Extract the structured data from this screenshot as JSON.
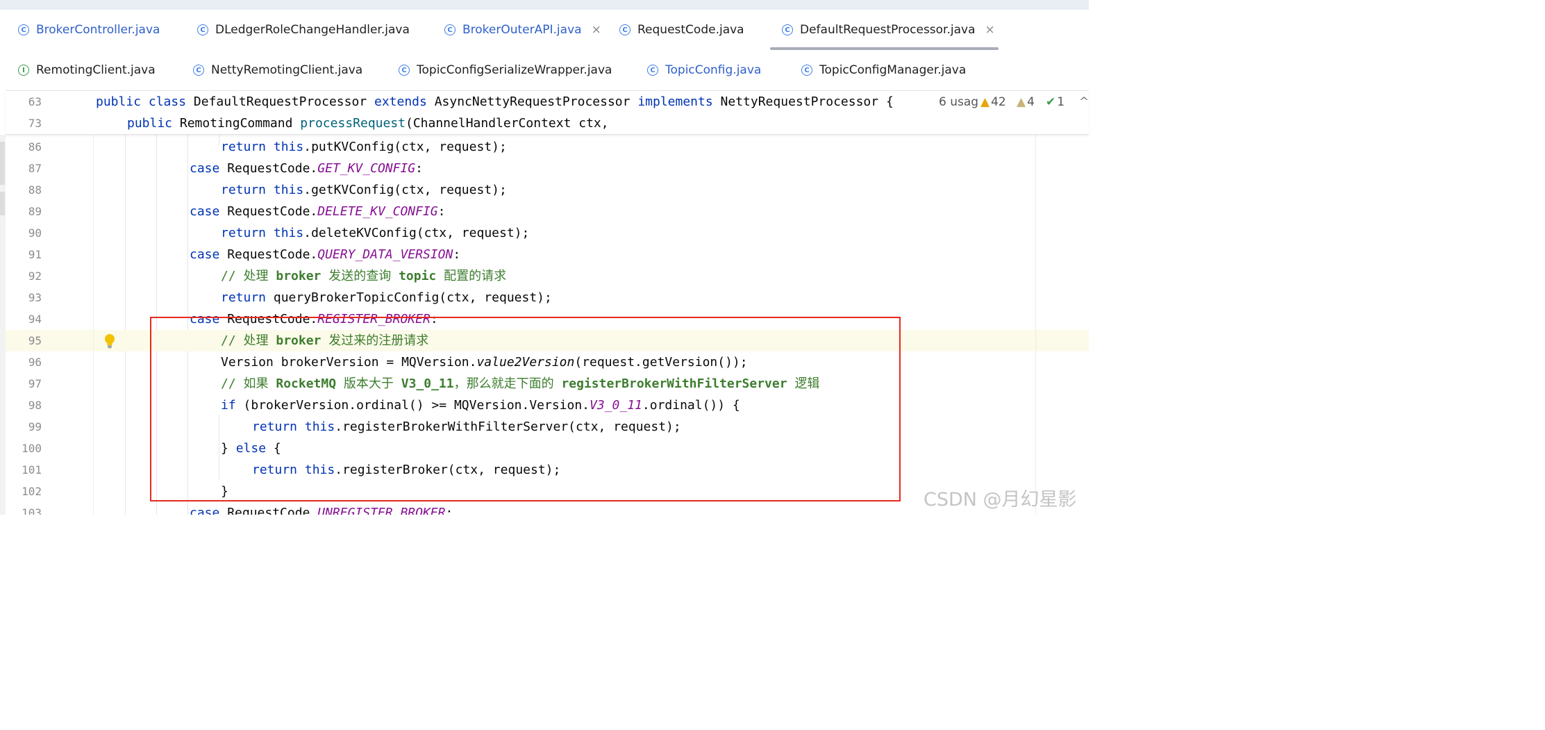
{
  "tabs_row1": [
    {
      "label": "BrokerController.java",
      "icon": "class-icon",
      "style": "blue",
      "close": false
    },
    {
      "label": "DLedgerRoleChangeHandler.java",
      "icon": "class-icon",
      "style": "normal",
      "close": false
    },
    {
      "label": "BrokerOuterAPI.java",
      "icon": "class-icon",
      "style": "blue",
      "close": true
    },
    {
      "label": "RequestCode.java",
      "icon": "class-icon",
      "style": "normal",
      "close": false
    },
    {
      "label": "DefaultRequestProcessor.java",
      "icon": "class-icon",
      "style": "active",
      "close": true
    }
  ],
  "tabs_row2": [
    {
      "label": "RemotingClient.java",
      "icon": "interface-icon",
      "style": "normal"
    },
    {
      "label": "NettyRemotingClient.java",
      "icon": "class-icon",
      "style": "normal"
    },
    {
      "label": "TopicConfigSerializeWrapper.java",
      "icon": "class-icon",
      "style": "normal"
    },
    {
      "label": "TopicConfig.java",
      "icon": "class-icon",
      "style": "blue"
    },
    {
      "label": "TopicConfigManager.java",
      "icon": "class-icon",
      "style": "normal"
    }
  ],
  "icon_glyphs": {
    "class": "C",
    "interface": "I",
    "close": "×"
  },
  "sticky": {
    "line63": "63",
    "line73": "73",
    "usages": "6 usag",
    "warnings": "42",
    "weak_warnings": "4",
    "typos": "1"
  },
  "line_numbers": [
    "86",
    "87",
    "88",
    "89",
    "90",
    "91",
    "92",
    "93",
    "94",
    "95",
    "96",
    "97",
    "98",
    "99",
    "100",
    "101",
    "102",
    "103"
  ],
  "code": {
    "kw_public": "public",
    "kw_class": "class",
    "class_name": "DefaultRequestProcessor",
    "kw_extends": "extends",
    "super_name": "AsyncNettyRequestProcessor",
    "kw_implements": "implements",
    "iface_name": "NettyRequestProcessor",
    "brace": "{",
    "ret_type": "RemotingCommand",
    "method_name": "processRequest",
    "method_args": "(ChannelHandlerContext ctx,",
    "kw_return": "return",
    "kw_this": "this",
    "kw_case": "case",
    "kw_if": "if",
    "kw_else": "else",
    "put_call": ".putKVConfig(ctx, request);",
    "get_call": ".getKVConfig(ctx, request);",
    "delete_call": ".deleteKVConfig(ctx, request);",
    "request_code": "RequestCode.",
    "const_get": "GET_KV_CONFIG",
    "const_delete": "DELETE_KV_CONFIG",
    "const_query": "QUERY_DATA_VERSION",
    "const_register": "REGISTER_BROKER",
    "const_unregister": "UNREGISTER_BROKER",
    "colon": ":",
    "comment92_a": "// 处理 ",
    "comment92_b": "broker",
    "comment92_c": " 发送的查询 ",
    "comment92_d": "topic",
    "comment92_e": " 配置的请求",
    "query_call": " queryBrokerTopicConfig(ctx, request);",
    "comment95_a": "// 处理 ",
    "comment95_b": "broker",
    "comment95_c": " 发过来的注册请求",
    "line96_a": "Version brokerVersion = MQVersion.",
    "line96_b": "value2Version",
    "line96_c": "(request.getVersion());",
    "comment97_a": "// 如果 ",
    "comment97_b": "RocketMQ",
    "comment97_c": " 版本大于 ",
    "comment97_d": "V3_0_11",
    "comment97_e": "，那么就走下面的 ",
    "comment97_f": "registerBrokerWithFilterServer",
    "comment97_g": " 逻辑",
    "line98_a": " (brokerVersion.ordinal() >= MQVersion.Version.",
    "line98_b": "V3_0_11",
    "line98_c": ".ordinal()) {",
    "line99_call": ".registerBrokerWithFilterServer(ctx, request);",
    "line100_a": "} ",
    "line100_b": " {",
    "line101_call": ".registerBroker(ctx, request);",
    "line102": "}"
  },
  "watermark": "CSDN @月幻星影",
  "colors": {
    "keyword": "#0033b3",
    "method": "#00627a",
    "constant": "#871094",
    "comment": "#3d7d2e",
    "highlight_box": "#e8281e"
  }
}
